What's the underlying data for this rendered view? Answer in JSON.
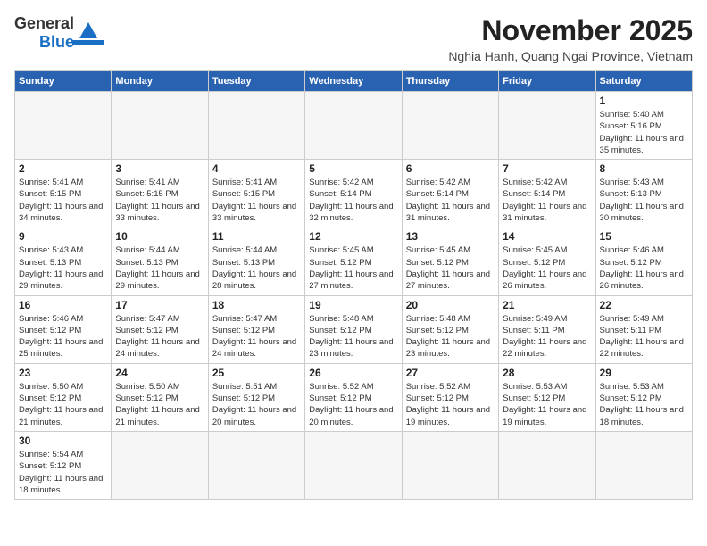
{
  "header": {
    "logo_text_general": "General",
    "logo_text_blue": "Blue",
    "month_title": "November 2025",
    "subtitle": "Nghia Hanh, Quang Ngai Province, Vietnam"
  },
  "weekdays": [
    "Sunday",
    "Monday",
    "Tuesday",
    "Wednesday",
    "Thursday",
    "Friday",
    "Saturday"
  ],
  "weeks": [
    [
      {
        "day": null
      },
      {
        "day": null
      },
      {
        "day": null
      },
      {
        "day": null
      },
      {
        "day": null
      },
      {
        "day": null
      },
      {
        "day": 1,
        "sunrise": "5:40 AM",
        "sunset": "5:16 PM",
        "daylight": "11 hours and 35 minutes."
      }
    ],
    [
      {
        "day": 2,
        "sunrise": "5:41 AM",
        "sunset": "5:15 PM",
        "daylight": "11 hours and 34 minutes."
      },
      {
        "day": 3,
        "sunrise": "5:41 AM",
        "sunset": "5:15 PM",
        "daylight": "11 hours and 33 minutes."
      },
      {
        "day": 4,
        "sunrise": "5:41 AM",
        "sunset": "5:15 PM",
        "daylight": "11 hours and 33 minutes."
      },
      {
        "day": 5,
        "sunrise": "5:42 AM",
        "sunset": "5:14 PM",
        "daylight": "11 hours and 32 minutes."
      },
      {
        "day": 6,
        "sunrise": "5:42 AM",
        "sunset": "5:14 PM",
        "daylight": "11 hours and 31 minutes."
      },
      {
        "day": 7,
        "sunrise": "5:42 AM",
        "sunset": "5:14 PM",
        "daylight": "11 hours and 31 minutes."
      },
      {
        "day": 8,
        "sunrise": "5:43 AM",
        "sunset": "5:13 PM",
        "daylight": "11 hours and 30 minutes."
      }
    ],
    [
      {
        "day": 9,
        "sunrise": "5:43 AM",
        "sunset": "5:13 PM",
        "daylight": "11 hours and 29 minutes."
      },
      {
        "day": 10,
        "sunrise": "5:44 AM",
        "sunset": "5:13 PM",
        "daylight": "11 hours and 29 minutes."
      },
      {
        "day": 11,
        "sunrise": "5:44 AM",
        "sunset": "5:13 PM",
        "daylight": "11 hours and 28 minutes."
      },
      {
        "day": 12,
        "sunrise": "5:45 AM",
        "sunset": "5:12 PM",
        "daylight": "11 hours and 27 minutes."
      },
      {
        "day": 13,
        "sunrise": "5:45 AM",
        "sunset": "5:12 PM",
        "daylight": "11 hours and 27 minutes."
      },
      {
        "day": 14,
        "sunrise": "5:45 AM",
        "sunset": "5:12 PM",
        "daylight": "11 hours and 26 minutes."
      },
      {
        "day": 15,
        "sunrise": "5:46 AM",
        "sunset": "5:12 PM",
        "daylight": "11 hours and 26 minutes."
      }
    ],
    [
      {
        "day": 16,
        "sunrise": "5:46 AM",
        "sunset": "5:12 PM",
        "daylight": "11 hours and 25 minutes."
      },
      {
        "day": 17,
        "sunrise": "5:47 AM",
        "sunset": "5:12 PM",
        "daylight": "11 hours and 24 minutes."
      },
      {
        "day": 18,
        "sunrise": "5:47 AM",
        "sunset": "5:12 PM",
        "daylight": "11 hours and 24 minutes."
      },
      {
        "day": 19,
        "sunrise": "5:48 AM",
        "sunset": "5:12 PM",
        "daylight": "11 hours and 23 minutes."
      },
      {
        "day": 20,
        "sunrise": "5:48 AM",
        "sunset": "5:12 PM",
        "daylight": "11 hours and 23 minutes."
      },
      {
        "day": 21,
        "sunrise": "5:49 AM",
        "sunset": "5:11 PM",
        "daylight": "11 hours and 22 minutes."
      },
      {
        "day": 22,
        "sunrise": "5:49 AM",
        "sunset": "5:11 PM",
        "daylight": "11 hours and 22 minutes."
      }
    ],
    [
      {
        "day": 23,
        "sunrise": "5:50 AM",
        "sunset": "5:12 PM",
        "daylight": "11 hours and 21 minutes."
      },
      {
        "day": 24,
        "sunrise": "5:50 AM",
        "sunset": "5:12 PM",
        "daylight": "11 hours and 21 minutes."
      },
      {
        "day": 25,
        "sunrise": "5:51 AM",
        "sunset": "5:12 PM",
        "daylight": "11 hours and 20 minutes."
      },
      {
        "day": 26,
        "sunrise": "5:52 AM",
        "sunset": "5:12 PM",
        "daylight": "11 hours and 20 minutes."
      },
      {
        "day": 27,
        "sunrise": "5:52 AM",
        "sunset": "5:12 PM",
        "daylight": "11 hours and 19 minutes."
      },
      {
        "day": 28,
        "sunrise": "5:53 AM",
        "sunset": "5:12 PM",
        "daylight": "11 hours and 19 minutes."
      },
      {
        "day": 29,
        "sunrise": "5:53 AM",
        "sunset": "5:12 PM",
        "daylight": "11 hours and 18 minutes."
      }
    ],
    [
      {
        "day": 30,
        "sunrise": "5:54 AM",
        "sunset": "5:12 PM",
        "daylight": "11 hours and 18 minutes."
      },
      {
        "day": null
      },
      {
        "day": null
      },
      {
        "day": null
      },
      {
        "day": null
      },
      {
        "day": null
      },
      {
        "day": null
      }
    ]
  ]
}
